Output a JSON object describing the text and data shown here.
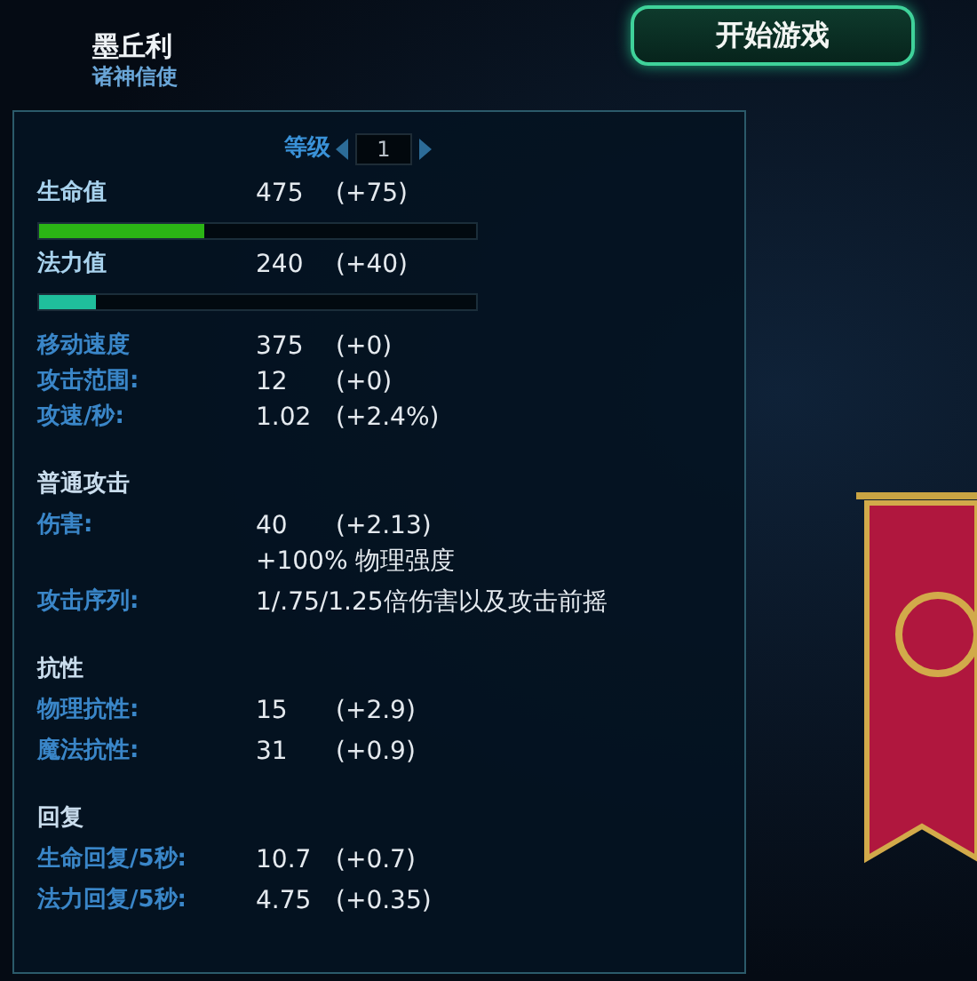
{
  "hero": {
    "name": "墨丘利",
    "title": "诸神信使"
  },
  "start_button": "开始游戏",
  "level": {
    "label": "等级",
    "value": "1"
  },
  "resources": [
    {
      "label": "生命值",
      "value": "475",
      "bonus": "(+75)",
      "level": 0.38,
      "color": "#2bb515"
    },
    {
      "label": "法力值",
      "value": "240",
      "bonus": "(+40)",
      "level": 0.13,
      "color": "#1fbf9c"
    }
  ],
  "sections": [
    {
      "rows": [
        {
          "label": "移动速度",
          "value": "375",
          "bonus": "(+0)"
        },
        {
          "label": "攻击范围:",
          "value": "12",
          "bonus": "(+0)"
        },
        {
          "label": "攻速/秒:",
          "value": "1.02",
          "bonus": "(+2.4%)"
        }
      ]
    },
    {
      "heading": "普通攻击",
      "rows": [
        {
          "label": "伤害:",
          "value": "40",
          "bonus": "(+2.13)",
          "note": "+100% 物理强度"
        },
        {
          "label": "攻击序列:",
          "value": "1/.75/1.25倍伤害以及攻击前摇"
        }
      ]
    },
    {
      "heading": "抗性",
      "rows": [
        {
          "label": "物理抗性:",
          "value": "15",
          "bonus": "(+2.9)"
        },
        {
          "label": "魔法抗性:",
          "value": "31",
          "bonus": "(+0.9)"
        }
      ]
    },
    {
      "heading": "回复",
      "rows": [
        {
          "label": "生命回复/5秒:",
          "value": "10.7",
          "bonus": "(+0.7)"
        },
        {
          "label": "法力回复/5秒:",
          "value": "4.75",
          "bonus": "(+0.35)"
        }
      ]
    }
  ]
}
